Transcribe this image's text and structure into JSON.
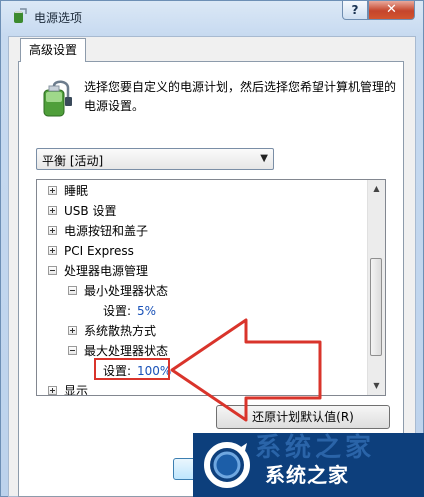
{
  "window": {
    "title": "电源选项",
    "help_label": "?",
    "close_label": "✕"
  },
  "tab": {
    "label": "高级设置"
  },
  "description": "选择您要自定义的电源计划，然后选择您希望计算机管理的电源设置。",
  "plan_select": {
    "value": "平衡 [活动]"
  },
  "tree": {
    "sleep": "睡眠",
    "usb": "USB 设置",
    "power_buttons": "电源按钮和盖子",
    "pci": "PCI Express",
    "cpu_mgmt": "处理器电源管理",
    "min_state": "最小处理器状态",
    "min_setting_label": "设置:",
    "min_setting_value": "5%",
    "cooling": "系统散热方式",
    "max_state": "最大处理器状态",
    "max_setting_label": "设置:",
    "max_setting_value": "100%",
    "display": "显示"
  },
  "restore_button": "还原计划默认值(R)",
  "watermark": {
    "text": "系统之家",
    "faded": "系统之家"
  },
  "colors": {
    "highlight": "#d9342b",
    "link": "#1a52b8",
    "accent": "#0d3f7c"
  }
}
